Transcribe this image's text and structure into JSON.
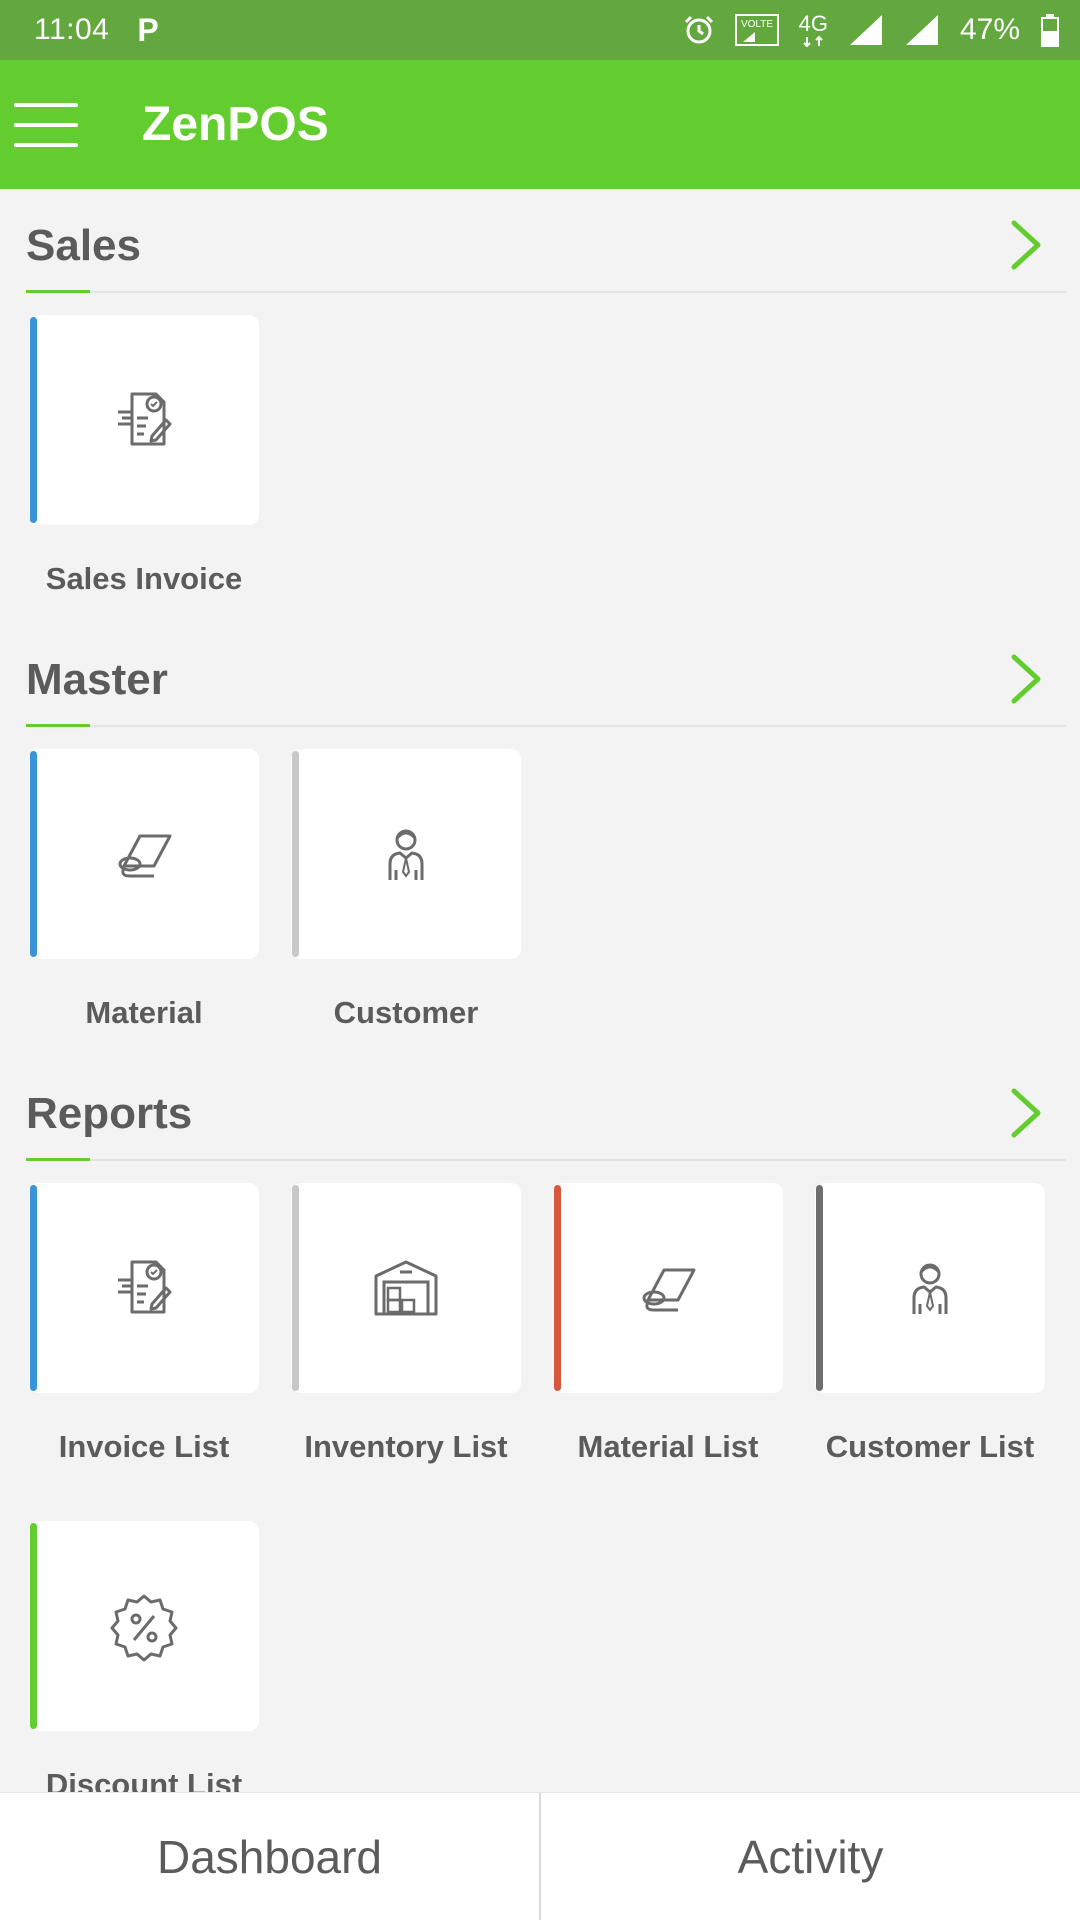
{
  "status_bar": {
    "time": "11:04",
    "app_indicator": "P",
    "volte": "VOLTE",
    "network": "4G",
    "battery": "47%"
  },
  "app_bar": {
    "title": "ZenPOS",
    "menu_icon": "hamburger-menu-icon"
  },
  "colors": {
    "status_bar": "#63a83e",
    "app_bar": "#63cc2f",
    "accent_blue": "#3a93d8",
    "accent_grey": "#c8c8c8",
    "accent_red": "#d9573c",
    "accent_dark": "#6e6e6e",
    "accent_green": "#63cc2f"
  },
  "sections": [
    {
      "title": "Sales",
      "tiles": [
        {
          "label": "Sales Invoice",
          "icon": "invoice-icon",
          "accent": "#3a93d8"
        }
      ]
    },
    {
      "title": "Master",
      "tiles": [
        {
          "label": "Material",
          "icon": "material-roll-icon",
          "accent": "#3a93d8"
        },
        {
          "label": "Customer",
          "icon": "customer-icon",
          "accent": "#c8c8c8"
        }
      ]
    },
    {
      "title": "Reports",
      "tiles": [
        {
          "label": "Invoice List",
          "icon": "invoice-icon",
          "accent": "#3a93d8"
        },
        {
          "label": "Inventory List",
          "icon": "warehouse-icon",
          "accent": "#c8c8c8"
        },
        {
          "label": "Material List",
          "icon": "material-roll-icon",
          "accent": "#d9573c"
        },
        {
          "label": "Customer List",
          "icon": "customer-icon",
          "accent": "#6e6e6e"
        },
        {
          "label": "Discount List",
          "icon": "discount-icon",
          "accent": "#63cc2f"
        }
      ]
    }
  ],
  "bottom_nav": {
    "dashboard": "Dashboard",
    "activity": "Activity"
  }
}
